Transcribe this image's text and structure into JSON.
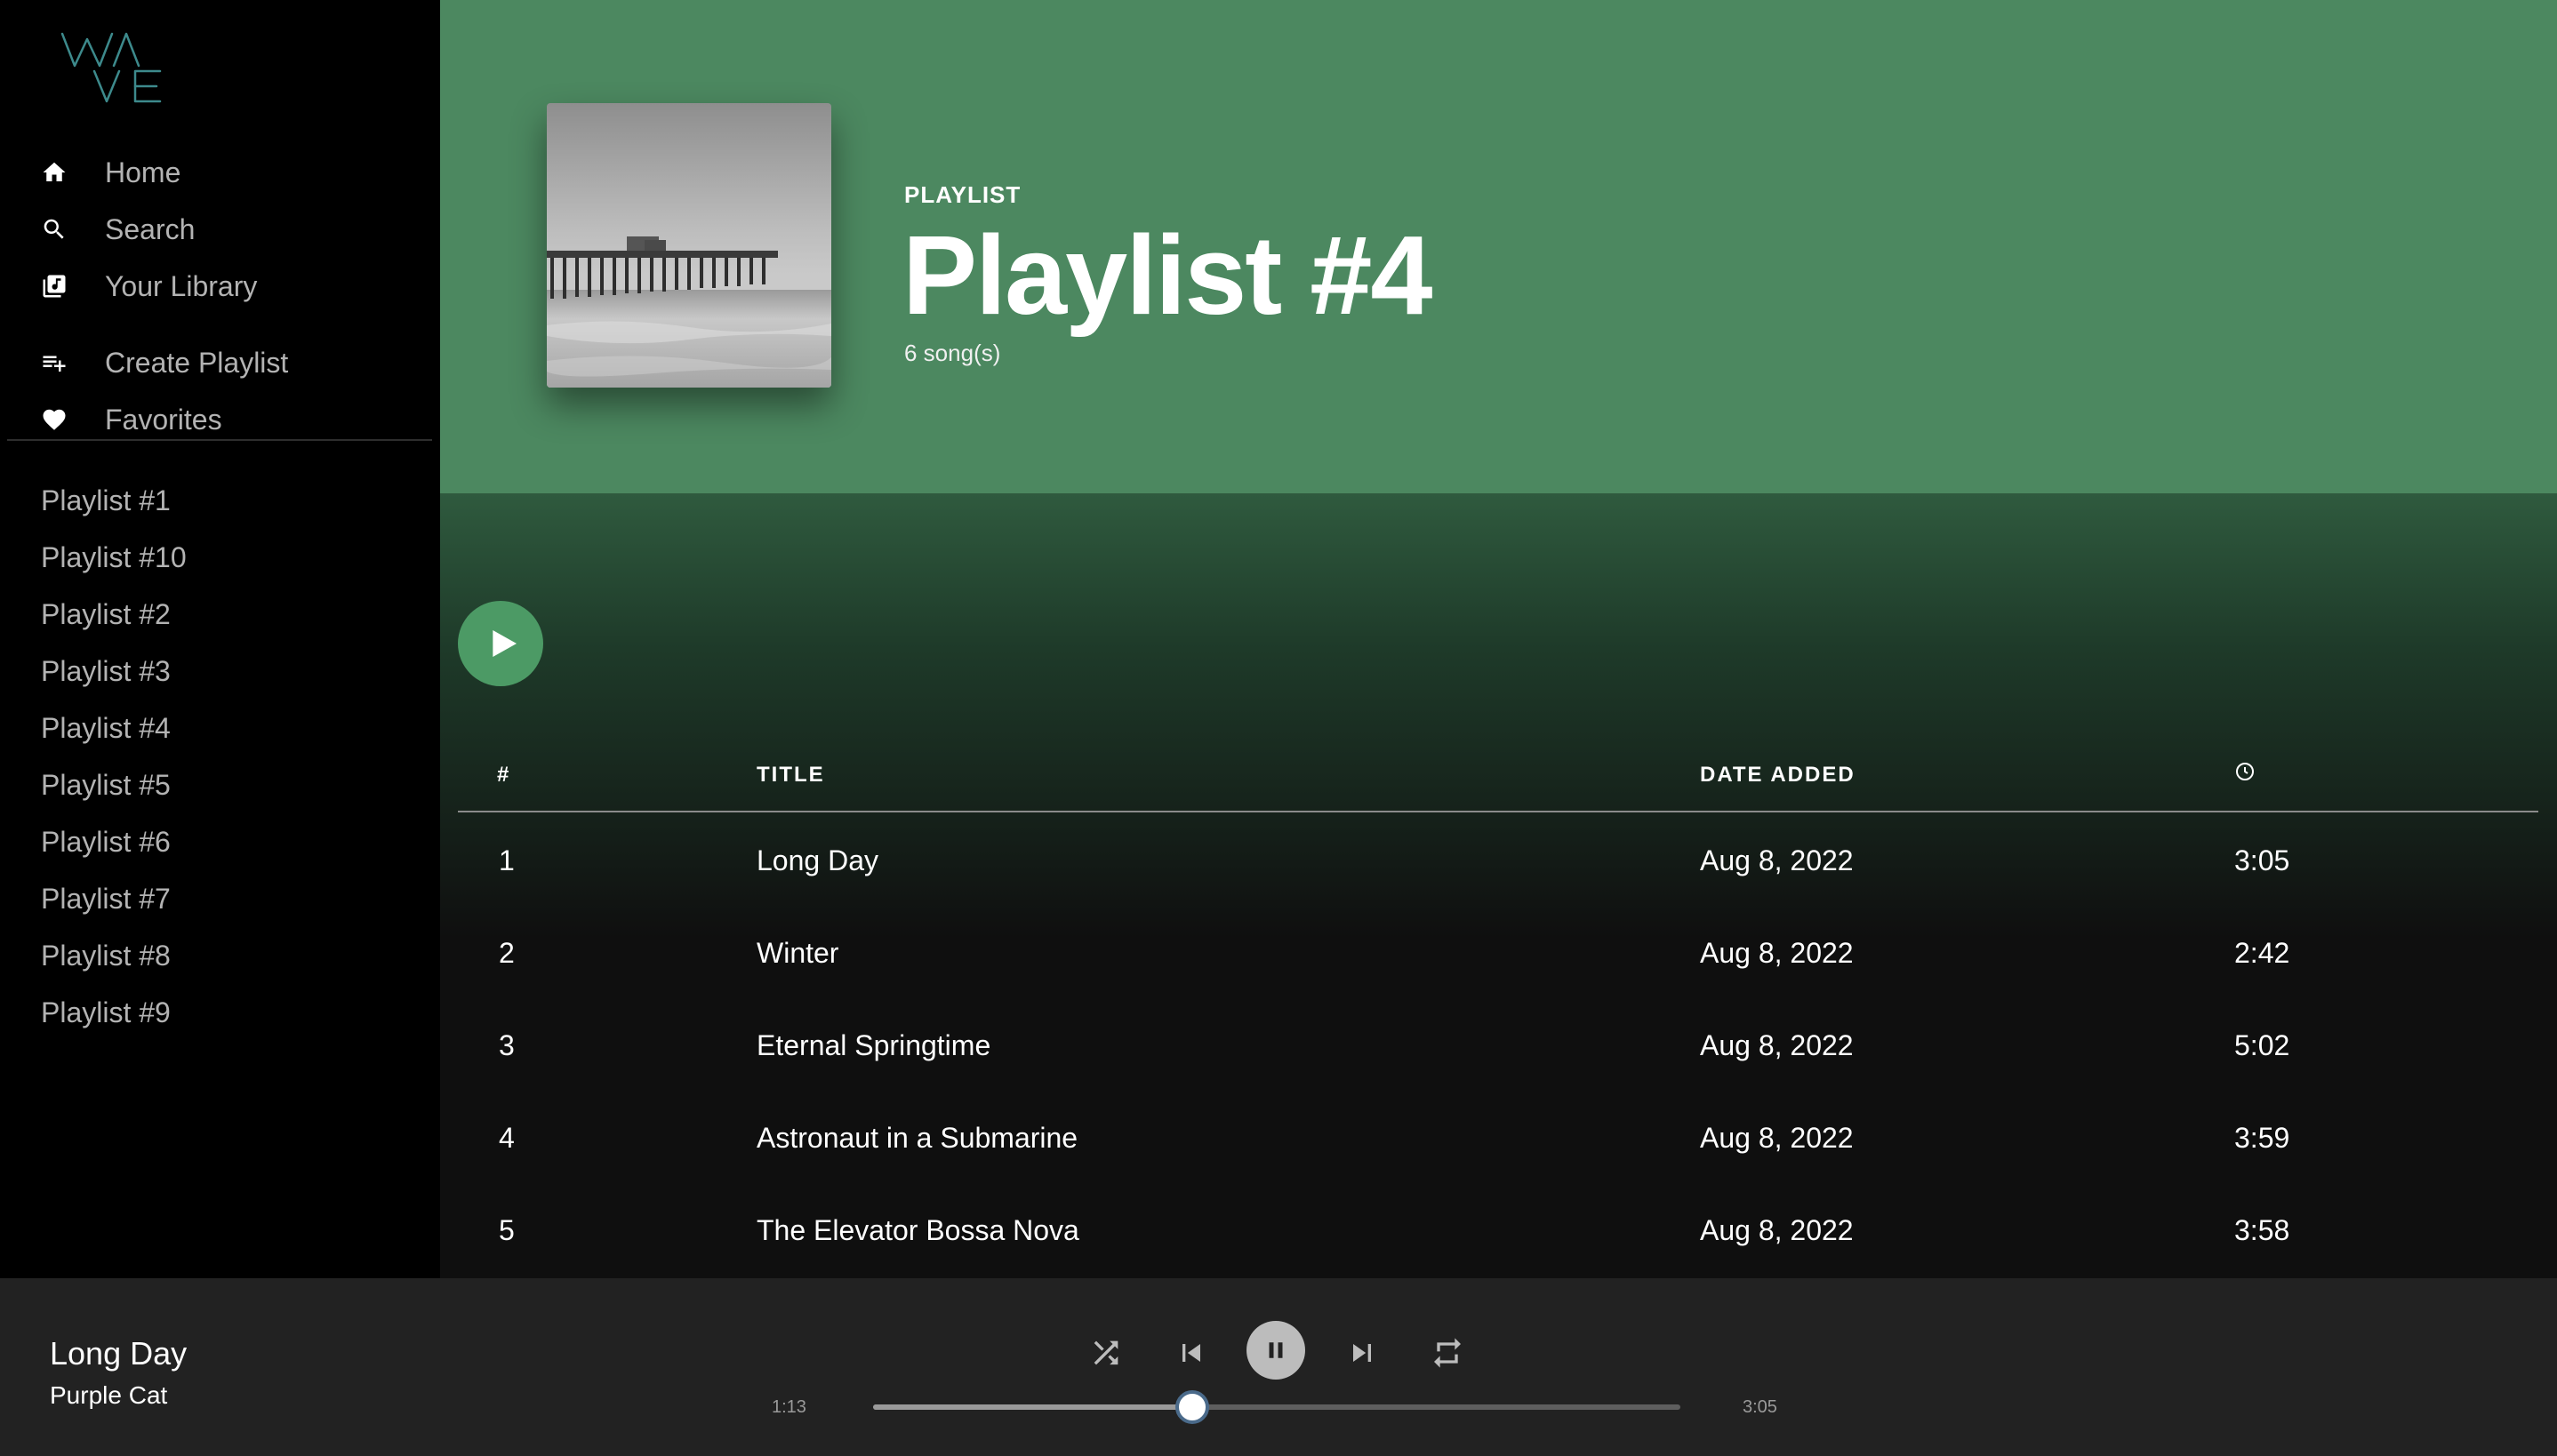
{
  "app": {
    "logo_text": "WAVE",
    "accent_color": "#4c8860",
    "logo_color": "#3d8a8c"
  },
  "sidebar": {
    "nav": [
      {
        "label": "Home",
        "icon": "home-icon"
      },
      {
        "label": "Search",
        "icon": "search-icon"
      },
      {
        "label": "Your Library",
        "icon": "library-icon"
      },
      {
        "label": "Create Playlist",
        "icon": "playlist-add-icon"
      },
      {
        "label": "Favorites",
        "icon": "heart-icon"
      }
    ],
    "playlists": [
      "Playlist #1",
      "Playlist #10",
      "Playlist #2",
      "Playlist #3",
      "Playlist #4",
      "Playlist #5",
      "Playlist #6",
      "Playlist #7",
      "Playlist #8",
      "Playlist #9"
    ]
  },
  "header": {
    "kicker": "PLAYLIST",
    "title": "Playlist #4",
    "song_count": "6 song(s)"
  },
  "table": {
    "columns": {
      "number": "#",
      "title": "TITLE",
      "date_added": "DATE ADDED",
      "duration_icon": "clock-icon"
    },
    "rows": [
      {
        "num": "1",
        "title": "Long Day",
        "date": "Aug 8, 2022",
        "duration": "3:05"
      },
      {
        "num": "2",
        "title": "Winter",
        "date": "Aug 8, 2022",
        "duration": "2:42"
      },
      {
        "num": "3",
        "title": "Eternal Springtime",
        "date": "Aug 8, 2022",
        "duration": "5:02"
      },
      {
        "num": "4",
        "title": "Astronaut in a Submarine",
        "date": "Aug 8, 2022",
        "duration": "3:59"
      },
      {
        "num": "5",
        "title": "The Elevator Bossa Nova",
        "date": "Aug 8, 2022",
        "duration": "3:58"
      }
    ]
  },
  "player": {
    "track_title": "Long Day",
    "artist": "Purple Cat",
    "elapsed": "1:13",
    "total": "3:05",
    "progress": 0.395
  }
}
